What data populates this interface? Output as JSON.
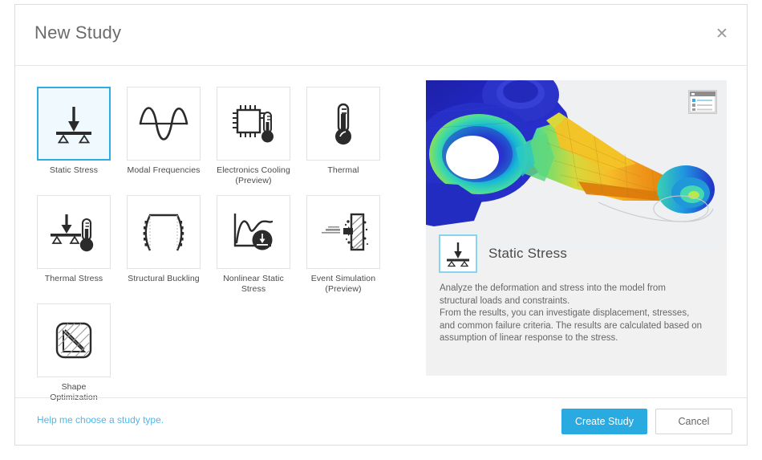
{
  "dialog": {
    "title": "New Study",
    "close_icon": "close-icon"
  },
  "study_types": [
    {
      "id": "static-stress",
      "label": "Static Stress",
      "icon": "beam-load-icon",
      "selected": true
    },
    {
      "id": "modal-frequencies",
      "label": "Modal Frequencies",
      "icon": "sine-wave-icon",
      "selected": false
    },
    {
      "id": "electronics-cooling",
      "label": "Electronics Cooling\n(Preview)",
      "icon": "chip-thermometer-icon",
      "selected": false
    },
    {
      "id": "thermal",
      "label": "Thermal",
      "icon": "thermometer-icon",
      "selected": false
    },
    {
      "id": "thermal-stress",
      "label": "Thermal Stress",
      "icon": "beam-thermometer-icon",
      "selected": false
    },
    {
      "id": "structural-buckling",
      "label": "Structural Buckling",
      "icon": "buckling-icon",
      "selected": false
    },
    {
      "id": "nonlinear-static-stress",
      "label": "Nonlinear Static\nStress",
      "icon": "nonlinear-curve-icon",
      "selected": false
    },
    {
      "id": "event-simulation",
      "label": "Event Simulation\n(Preview)",
      "icon": "impact-icon",
      "selected": false
    },
    {
      "id": "shape-optimization",
      "label": "Shape Optimization",
      "icon": "shape-optimization-icon",
      "selected": false
    }
  ],
  "preview": {
    "title": "Static Stress",
    "icon": "beam-load-icon",
    "panel_icon": "results-panel-icon",
    "description_lines": [
      "Analyze the deformation and stress into the model from",
      "structural loads and constraints.",
      "From the results, you can investigate displacement, stresses,",
      "and common failure criteria. The results are calculated based on",
      "assumption of linear response to the stress."
    ]
  },
  "footer": {
    "help_link": "Help me choose a study type.",
    "create_label": "Create Study",
    "cancel_label": "Cancel"
  },
  "colors": {
    "accent": "#29abe2",
    "selected_border": "#2eaddf",
    "selected_fill": "#f0f9fd",
    "link": "#4db8ec",
    "panel_bg": "#f1f1f1",
    "title_text": "#6b6b6b",
    "body_text": "#666666"
  }
}
